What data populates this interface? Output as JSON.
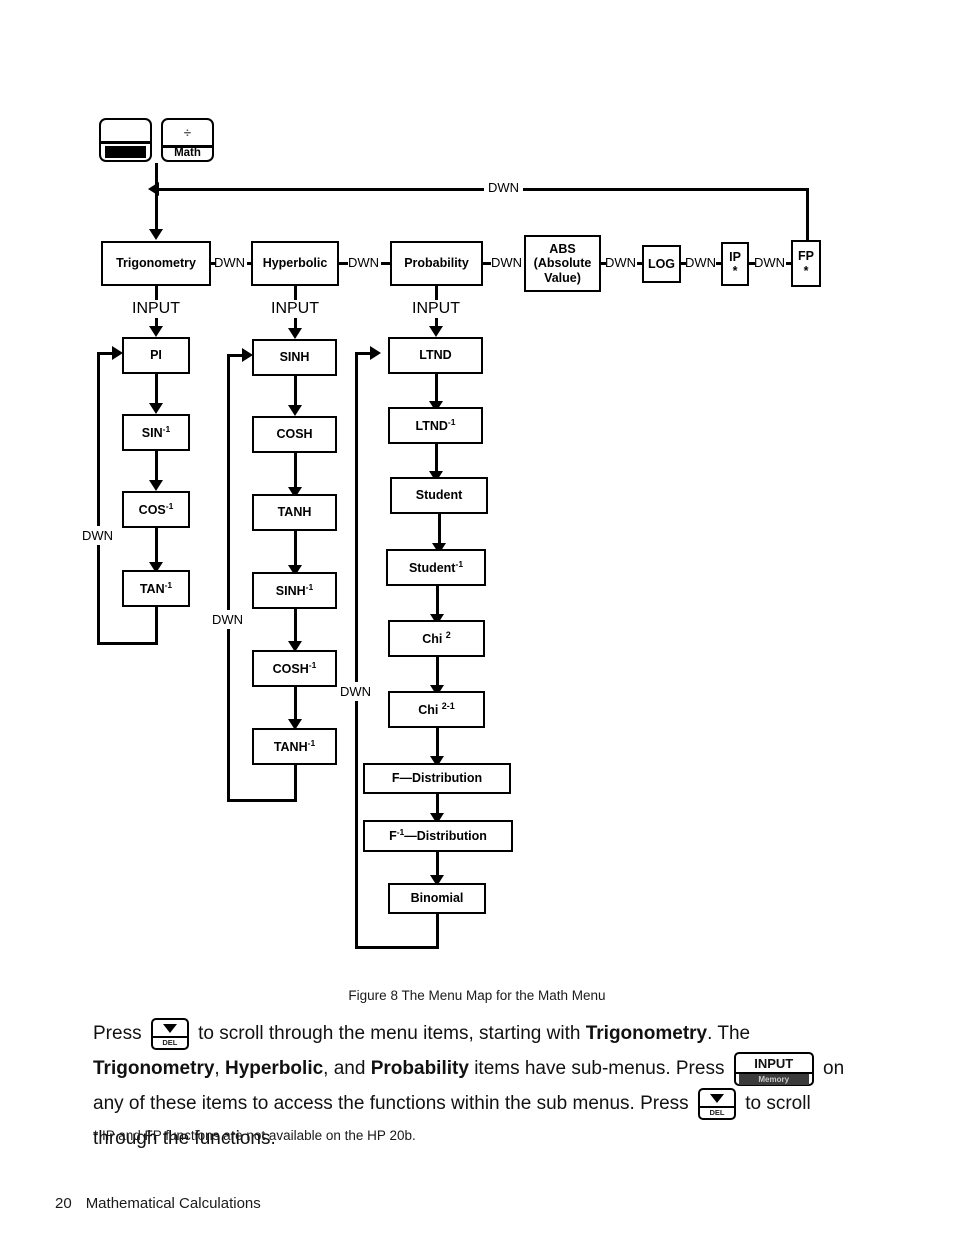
{
  "page": {
    "number": "20",
    "section": "Mathematical Calculations",
    "footnote": "* IP and FP functions are not available on the HP 20b.",
    "caption": "Figure 8  The Menu Map for the Math Menu"
  },
  "keys": {
    "shift_key": {
      "label": ""
    },
    "math_key": {
      "symbol": "÷",
      "label": "Math"
    }
  },
  "edge_labels": {
    "dwn": "DWN",
    "input": "INPUT"
  },
  "menu_row": {
    "items": [
      {
        "label": "Trigonometry"
      },
      {
        "label": "Hyperbolic"
      },
      {
        "label": "Probability"
      },
      {
        "label": "ABS",
        "sub": "(Absolute",
        "sub2": "Value)"
      },
      {
        "label": "LOG"
      },
      {
        "label": "IP",
        "note": "*"
      },
      {
        "label": "FP",
        "note": "*"
      }
    ]
  },
  "submenus": {
    "trigonometry": {
      "parent": "Trigonometry",
      "items": [
        "PI",
        "SIN-1",
        "COS-1",
        "TAN-1"
      ]
    },
    "hyperbolic": {
      "parent": "Hyperbolic",
      "items": [
        "SINH",
        "COSH",
        "TANH",
        "SINH-1",
        "COSH-1",
        "TANH-1"
      ]
    },
    "probability": {
      "parent": "Probability",
      "items": [
        "LTND",
        "LTND-1",
        "Student",
        "Student-1",
        "Chi 2",
        "Chi 2-1",
        "F—Distribution",
        "F-1—Distribution",
        "Binomial"
      ]
    }
  },
  "body": {
    "p1_a": "Press",
    "p1_b": "to scroll through the menu items, starting with",
    "p1_bold1": "Trigonometry",
    "p1_c": ". The",
    "p1_bold2": "Trigonometry",
    "p1_d": ",",
    "p2_bold1": "Hyperbolic",
    "p2_a": ", and",
    "p2_bold2": "Probability",
    "p2_b": "items have sub-menus. Press",
    "p2_c": "on any of these items to",
    "p3_a": "access the functions within the sub menus. Press",
    "p3_b": "to scroll through the functions."
  },
  "inline_keys": {
    "del_key": {
      "label": "DEL"
    },
    "input_key": {
      "top": "INPUT",
      "bottom": "Memory"
    }
  }
}
